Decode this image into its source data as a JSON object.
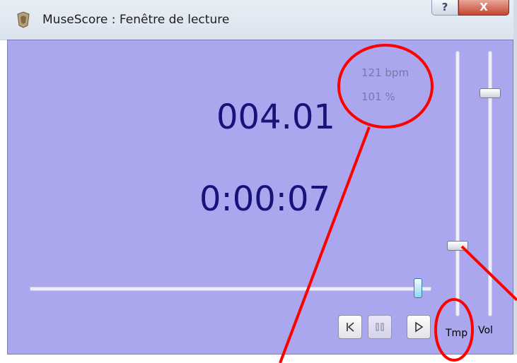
{
  "window": {
    "title": "MuseScore : Fenêtre de lecture",
    "help_glyph": "?",
    "close_glyph": "X"
  },
  "playback": {
    "tempo_bpm": "121 bpm",
    "relative_tempo": "101 %",
    "measure_position": "004.01",
    "elapsed_time": "0:00:07",
    "position_fraction": 0.97
  },
  "sliders": {
    "tempo_label": "Tmp",
    "volume_label": "Vol"
  },
  "transport": [
    {
      "icon": "rewind-icon"
    },
    {
      "icon": "pause-icon"
    },
    {
      "icon": "play-icon"
    }
  ],
  "colors": {
    "panel": "#aaa7ee",
    "display_text": "#16137a",
    "annotation": "#ff0000"
  }
}
